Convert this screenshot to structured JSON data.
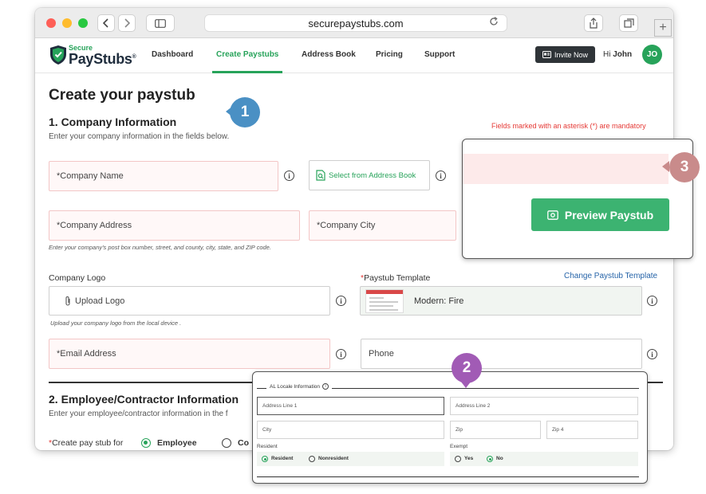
{
  "browser": {
    "url": "securepaystubs.com"
  },
  "brand": {
    "secure": "Secure",
    "name": "PayStubs",
    "mark": "®"
  },
  "nav": {
    "items": [
      "Dashboard",
      "Create Paystubs",
      "Address Book",
      "Pricing",
      "Support"
    ],
    "active": "Create Paystubs",
    "invite_label": "Invite Now",
    "greeting": "Hi",
    "user_name": "John",
    "avatar_initials": "JO"
  },
  "page": {
    "title": "Create your paystub",
    "mandatory_note": "Fields marked with an asterisk (*) are mandatory"
  },
  "company": {
    "section_title": "1. Company Information",
    "section_desc": "Enter your company information in the fields below.",
    "name_placeholder": "*Company Name",
    "address_book_label": "Select from Address Book",
    "address_placeholder": "*Company Address",
    "city_placeholder": "*Company City",
    "address_hint": "Enter your company's post box number, street, and county, city, state, and ZIP code.",
    "logo_label": "Company Logo",
    "upload_label": "Upload Logo",
    "upload_hint": "Upload your company logo from the local device .",
    "template_label": "*Paystub Template",
    "template_label_text": "Paystub Template",
    "change_template_link": "Change Paystub Template",
    "template_value": "Modern: Fire",
    "email_placeholder": "*Email Address",
    "phone_placeholder": "Phone"
  },
  "employee": {
    "section_title": "2. Employee/Contractor Information",
    "section_desc": "Enter your employee/contractor information in the f",
    "paystub_for_label": "Create pay stub for",
    "options": [
      "Employee",
      "Co"
    ],
    "selected": "Employee"
  },
  "callouts": {
    "one": "1",
    "two": "2",
    "three": "3",
    "colors": {
      "one": "#4a90c4",
      "two": "#a15bb5",
      "three": "#c98b8b"
    }
  },
  "preview": {
    "button_label": "Preview Paystub"
  },
  "locale_panel": {
    "legend": "AL Locale Information",
    "address_line_1": "Address Line 1",
    "address_line_2": "Address Line 2",
    "city": "City",
    "zip": "Zip",
    "zip4": "Zip 4",
    "resident_label": "Resident",
    "resident_options": [
      "Resident",
      "Nonresident"
    ],
    "resident_selected": "Resident",
    "exempt_label": "Exempt",
    "exempt_options": [
      "Yes",
      "No"
    ],
    "exempt_selected": "No"
  },
  "colors": {
    "accent": "#27a35a",
    "required": "#e53935",
    "link": "#2563a8",
    "preview_button": "#3cb371"
  }
}
